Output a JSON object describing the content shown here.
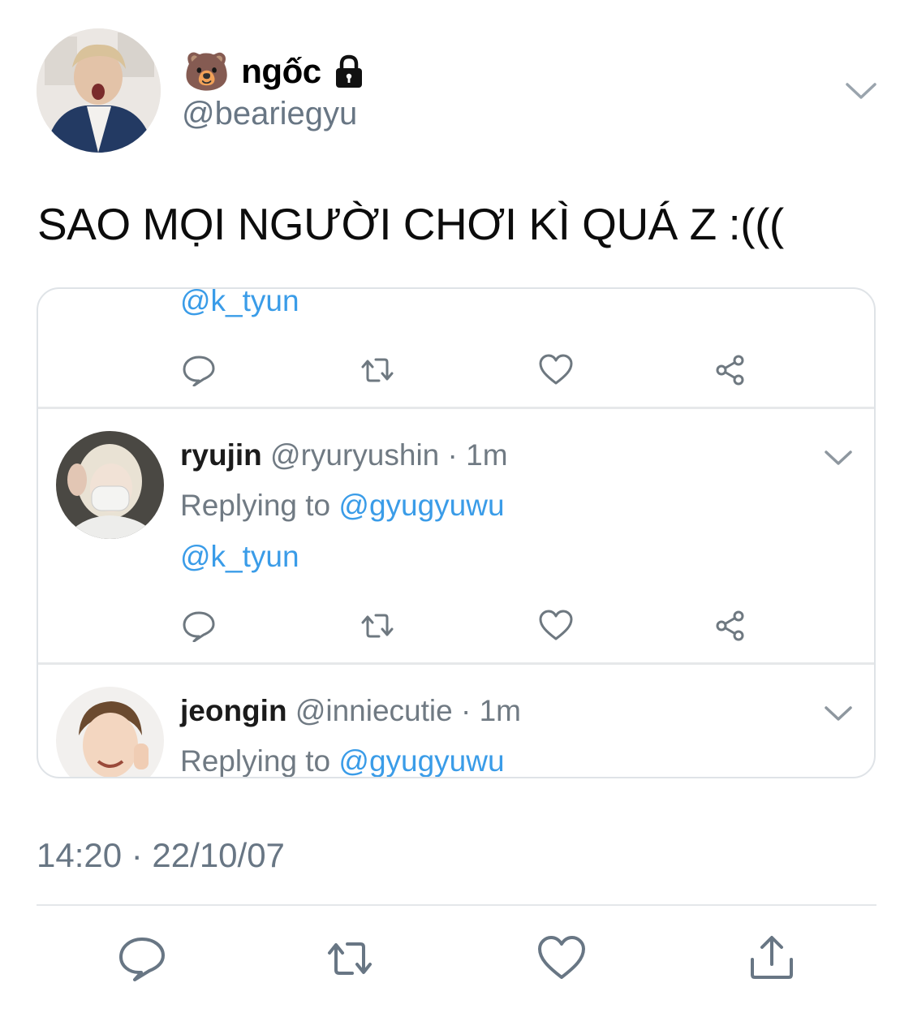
{
  "author": {
    "display_name": "ngốc",
    "name_emoji": "🐻",
    "handle": "@beariegyu",
    "locked_icon": "lock-icon"
  },
  "tweet": {
    "text": "SAO MỌI NGƯỜI CHƠI KÌ QUÁ Z :(((",
    "timestamp": "14:20 · 22/10/07"
  },
  "embedded": {
    "top_mention": "@k_tyun",
    "replies": [
      {
        "name": "ryujin",
        "meta": "@ryuryushin · 1m",
        "replying_label": "Replying to",
        "replying_to": "@gyugyuwu",
        "body": "@k_tyun"
      },
      {
        "name": "jeongin",
        "meta": "@inniecutie · 1m",
        "replying_label": "Replying to",
        "replying_to": "@gyugyuwu"
      }
    ]
  },
  "actions": [
    "reply-icon",
    "retweet-icon",
    "like-icon",
    "share-icon"
  ],
  "colors": {
    "link": "#3a9ce8",
    "secondary_text": "#687684",
    "icon": "#687684",
    "divider": "#e4e7ea"
  }
}
